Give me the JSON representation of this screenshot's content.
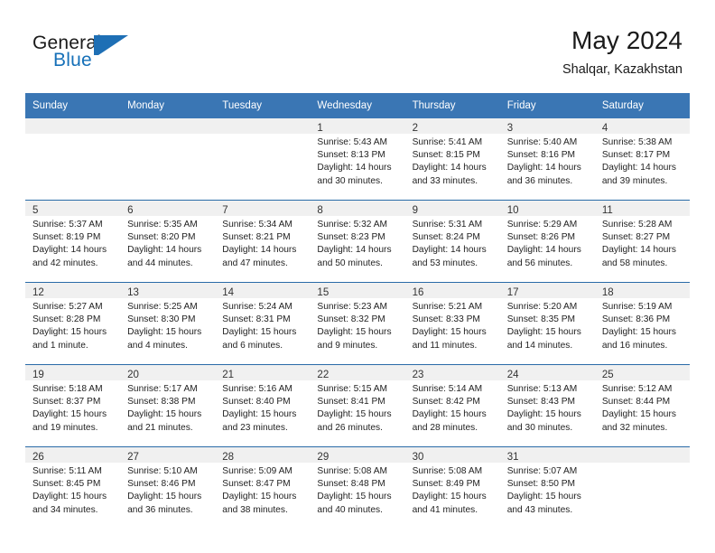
{
  "brand": {
    "word_one": "General",
    "word_two": "Blue",
    "flag_icon": "flag-triangle-icon",
    "accent_color": "#1670b8"
  },
  "header": {
    "month_title": "May 2024",
    "location": "Shalqar, Kazakhstan",
    "header_bg_color": "#3a76b4",
    "row_divider_color": "#2a6ba8",
    "daynum_band_color": "#f0f0f0"
  },
  "calendar": {
    "weekday_headers": [
      "Sunday",
      "Monday",
      "Tuesday",
      "Wednesday",
      "Thursday",
      "Friday",
      "Saturday"
    ],
    "labels": {
      "sunrise": "Sunrise:",
      "sunset": "Sunset:",
      "daylight": "Daylight:"
    },
    "weeks": [
      [
        {
          "day": "",
          "empty": true
        },
        {
          "day": "",
          "empty": true
        },
        {
          "day": "",
          "empty": true
        },
        {
          "day": "1",
          "sunrise": "Sunrise: 5:43 AM",
          "sunset": "Sunset: 8:13 PM",
          "daylight_1": "Daylight: 14 hours",
          "daylight_2": "and 30 minutes."
        },
        {
          "day": "2",
          "sunrise": "Sunrise: 5:41 AM",
          "sunset": "Sunset: 8:15 PM",
          "daylight_1": "Daylight: 14 hours",
          "daylight_2": "and 33 minutes."
        },
        {
          "day": "3",
          "sunrise": "Sunrise: 5:40 AM",
          "sunset": "Sunset: 8:16 PM",
          "daylight_1": "Daylight: 14 hours",
          "daylight_2": "and 36 minutes."
        },
        {
          "day": "4",
          "sunrise": "Sunrise: 5:38 AM",
          "sunset": "Sunset: 8:17 PM",
          "daylight_1": "Daylight: 14 hours",
          "daylight_2": "and 39 minutes."
        }
      ],
      [
        {
          "day": "5",
          "sunrise": "Sunrise: 5:37 AM",
          "sunset": "Sunset: 8:19 PM",
          "daylight_1": "Daylight: 14 hours",
          "daylight_2": "and 42 minutes."
        },
        {
          "day": "6",
          "sunrise": "Sunrise: 5:35 AM",
          "sunset": "Sunset: 8:20 PM",
          "daylight_1": "Daylight: 14 hours",
          "daylight_2": "and 44 minutes."
        },
        {
          "day": "7",
          "sunrise": "Sunrise: 5:34 AM",
          "sunset": "Sunset: 8:21 PM",
          "daylight_1": "Daylight: 14 hours",
          "daylight_2": "and 47 minutes."
        },
        {
          "day": "8",
          "sunrise": "Sunrise: 5:32 AM",
          "sunset": "Sunset: 8:23 PM",
          "daylight_1": "Daylight: 14 hours",
          "daylight_2": "and 50 minutes."
        },
        {
          "day": "9",
          "sunrise": "Sunrise: 5:31 AM",
          "sunset": "Sunset: 8:24 PM",
          "daylight_1": "Daylight: 14 hours",
          "daylight_2": "and 53 minutes."
        },
        {
          "day": "10",
          "sunrise": "Sunrise: 5:29 AM",
          "sunset": "Sunset: 8:26 PM",
          "daylight_1": "Daylight: 14 hours",
          "daylight_2": "and 56 minutes."
        },
        {
          "day": "11",
          "sunrise": "Sunrise: 5:28 AM",
          "sunset": "Sunset: 8:27 PM",
          "daylight_1": "Daylight: 14 hours",
          "daylight_2": "and 58 minutes."
        }
      ],
      [
        {
          "day": "12",
          "sunrise": "Sunrise: 5:27 AM",
          "sunset": "Sunset: 8:28 PM",
          "daylight_1": "Daylight: 15 hours",
          "daylight_2": "and 1 minute."
        },
        {
          "day": "13",
          "sunrise": "Sunrise: 5:25 AM",
          "sunset": "Sunset: 8:30 PM",
          "daylight_1": "Daylight: 15 hours",
          "daylight_2": "and 4 minutes."
        },
        {
          "day": "14",
          "sunrise": "Sunrise: 5:24 AM",
          "sunset": "Sunset: 8:31 PM",
          "daylight_1": "Daylight: 15 hours",
          "daylight_2": "and 6 minutes."
        },
        {
          "day": "15",
          "sunrise": "Sunrise: 5:23 AM",
          "sunset": "Sunset: 8:32 PM",
          "daylight_1": "Daylight: 15 hours",
          "daylight_2": "and 9 minutes."
        },
        {
          "day": "16",
          "sunrise": "Sunrise: 5:21 AM",
          "sunset": "Sunset: 8:33 PM",
          "daylight_1": "Daylight: 15 hours",
          "daylight_2": "and 11 minutes."
        },
        {
          "day": "17",
          "sunrise": "Sunrise: 5:20 AM",
          "sunset": "Sunset: 8:35 PM",
          "daylight_1": "Daylight: 15 hours",
          "daylight_2": "and 14 minutes."
        },
        {
          "day": "18",
          "sunrise": "Sunrise: 5:19 AM",
          "sunset": "Sunset: 8:36 PM",
          "daylight_1": "Daylight: 15 hours",
          "daylight_2": "and 16 minutes."
        }
      ],
      [
        {
          "day": "19",
          "sunrise": "Sunrise: 5:18 AM",
          "sunset": "Sunset: 8:37 PM",
          "daylight_1": "Daylight: 15 hours",
          "daylight_2": "and 19 minutes."
        },
        {
          "day": "20",
          "sunrise": "Sunrise: 5:17 AM",
          "sunset": "Sunset: 8:38 PM",
          "daylight_1": "Daylight: 15 hours",
          "daylight_2": "and 21 minutes."
        },
        {
          "day": "21",
          "sunrise": "Sunrise: 5:16 AM",
          "sunset": "Sunset: 8:40 PM",
          "daylight_1": "Daylight: 15 hours",
          "daylight_2": "and 23 minutes."
        },
        {
          "day": "22",
          "sunrise": "Sunrise: 5:15 AM",
          "sunset": "Sunset: 8:41 PM",
          "daylight_1": "Daylight: 15 hours",
          "daylight_2": "and 26 minutes."
        },
        {
          "day": "23",
          "sunrise": "Sunrise: 5:14 AM",
          "sunset": "Sunset: 8:42 PM",
          "daylight_1": "Daylight: 15 hours",
          "daylight_2": "and 28 minutes."
        },
        {
          "day": "24",
          "sunrise": "Sunrise: 5:13 AM",
          "sunset": "Sunset: 8:43 PM",
          "daylight_1": "Daylight: 15 hours",
          "daylight_2": "and 30 minutes."
        },
        {
          "day": "25",
          "sunrise": "Sunrise: 5:12 AM",
          "sunset": "Sunset: 8:44 PM",
          "daylight_1": "Daylight: 15 hours",
          "daylight_2": "and 32 minutes."
        }
      ],
      [
        {
          "day": "26",
          "sunrise": "Sunrise: 5:11 AM",
          "sunset": "Sunset: 8:45 PM",
          "daylight_1": "Daylight: 15 hours",
          "daylight_2": "and 34 minutes."
        },
        {
          "day": "27",
          "sunrise": "Sunrise: 5:10 AM",
          "sunset": "Sunset: 8:46 PM",
          "daylight_1": "Daylight: 15 hours",
          "daylight_2": "and 36 minutes."
        },
        {
          "day": "28",
          "sunrise": "Sunrise: 5:09 AM",
          "sunset": "Sunset: 8:47 PM",
          "daylight_1": "Daylight: 15 hours",
          "daylight_2": "and 38 minutes."
        },
        {
          "day": "29",
          "sunrise": "Sunrise: 5:08 AM",
          "sunset": "Sunset: 8:48 PM",
          "daylight_1": "Daylight: 15 hours",
          "daylight_2": "and 40 minutes."
        },
        {
          "day": "30",
          "sunrise": "Sunrise: 5:08 AM",
          "sunset": "Sunset: 8:49 PM",
          "daylight_1": "Daylight: 15 hours",
          "daylight_2": "and 41 minutes."
        },
        {
          "day": "31",
          "sunrise": "Sunrise: 5:07 AM",
          "sunset": "Sunset: 8:50 PM",
          "daylight_1": "Daylight: 15 hours",
          "daylight_2": "and 43 minutes."
        },
        {
          "day": "",
          "empty": true
        }
      ]
    ]
  }
}
